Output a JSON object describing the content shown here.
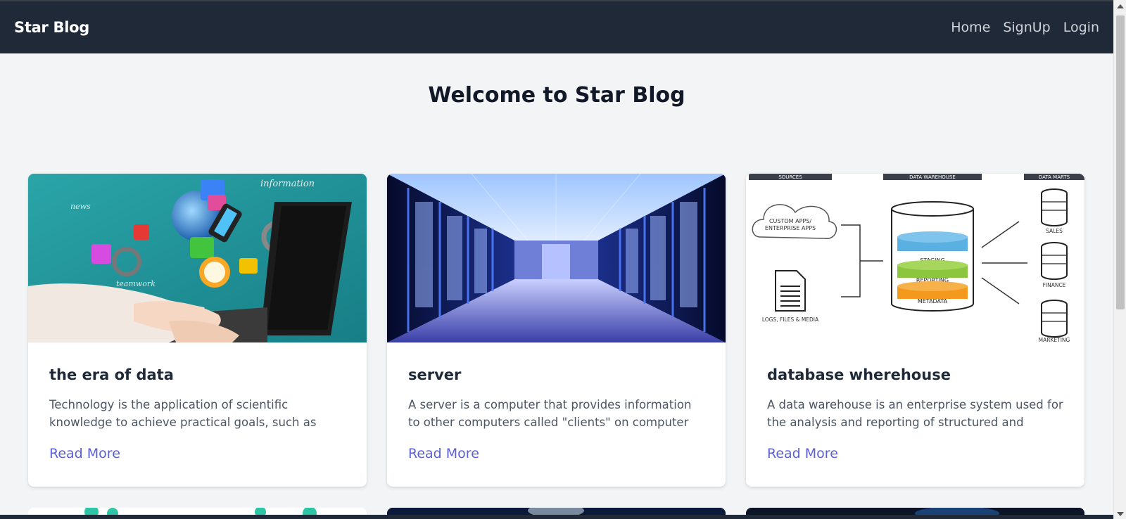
{
  "nav": {
    "brand": "Star Blog",
    "links": [
      "Home",
      "SignUp",
      "Login"
    ]
  },
  "page": {
    "heading": "Welcome to Star Blog"
  },
  "posts": [
    {
      "title": "the era of data",
      "excerpt": "Technology is the application of scientific knowledge to achieve practical goals, such as changing t...",
      "cta": "Read More"
    },
    {
      "title": "server",
      "excerpt": "A server is a computer that provides information to other computers called \"clients\" on computer net...",
      "cta": "Read More"
    },
    {
      "title": "database wherehouse",
      "excerpt": "A data warehouse is an enterprise system used for the analysis and reporting of structured and semi-...",
      "cta": "Read More"
    }
  ],
  "diagram": {
    "headers": [
      "SOURCES",
      "DATA WAREHOUSE",
      "DATA MARTS"
    ],
    "sources": [
      "CUSTOM APPS/",
      "ENTERPRISE APPS",
      "LOGS, FILES & MEDIA"
    ],
    "layers": [
      "STAGING",
      "REPORTING",
      "METADATA"
    ],
    "marts": [
      "SALES",
      "FINANCE",
      "MARKETING"
    ]
  },
  "colors": {
    "navbar": "#1f2937",
    "background": "#f3f4f6",
    "link": "#5a5fd6"
  }
}
